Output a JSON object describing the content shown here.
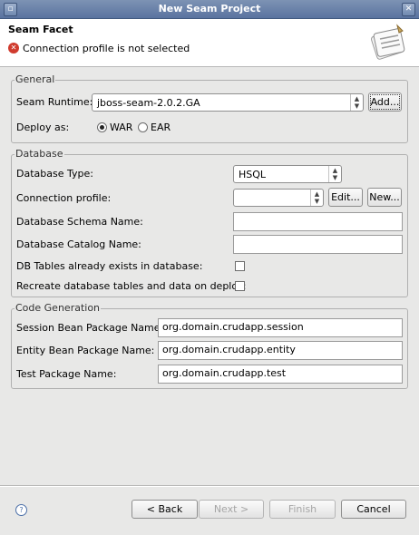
{
  "window": {
    "title": "New Seam Project"
  },
  "header": {
    "title": "Seam Facet",
    "message": "Connection profile is not selected",
    "message_icon": "error-icon"
  },
  "general": {
    "legend": "General",
    "runtime_label": "Seam Runtime:",
    "runtime_value": "jboss-seam-2.0.2.GA",
    "add_label": "Add...",
    "deploy_label": "Deploy as:",
    "deploy_options": [
      "WAR",
      "EAR"
    ],
    "deploy_selected": "WAR"
  },
  "database": {
    "legend": "Database",
    "type_label": "Database Type:",
    "type_value": "HSQL",
    "profile_label": "Connection profile:",
    "profile_value": "",
    "edit_label": "Edit...",
    "new_label": "New...",
    "schema_label": "Database Schema Name:",
    "schema_value": "",
    "catalog_label": "Database Catalog Name:",
    "catalog_value": "",
    "tables_exist_label": "DB Tables already exists in database:",
    "tables_exist_checked": false,
    "recreate_label": "Recreate database tables and data on deploy:",
    "recreate_checked": false
  },
  "codegen": {
    "legend": "Code Generation",
    "session_label": "Session Bean Package Name:",
    "session_value": "org.domain.crudapp.session",
    "entity_label": "Entity Bean Package Name:",
    "entity_value": "org.domain.crudapp.entity",
    "test_label": "Test Package Name:",
    "test_value": "org.domain.crudapp.test"
  },
  "footer": {
    "back_label": "< Back",
    "next_label": "Next >",
    "finish_label": "Finish",
    "cancel_label": "Cancel"
  }
}
